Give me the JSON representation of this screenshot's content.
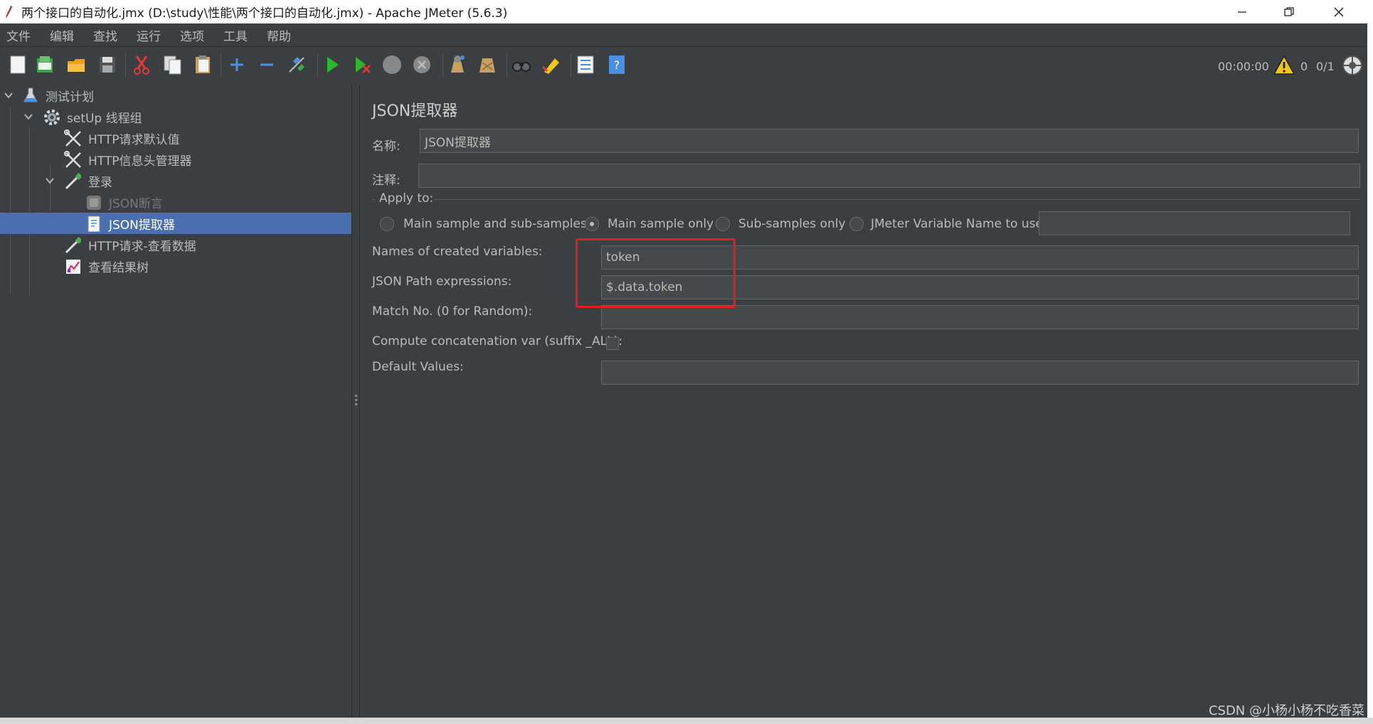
{
  "window": {
    "title": "两个接口的自动化.jmx (D:\\study\\性能\\两个接口的自动化.jmx) - Apache JMeter (5.6.3)",
    "minimize": "—",
    "maximize": "❐",
    "close": "✕"
  },
  "menu": [
    "文件",
    "编辑",
    "查找",
    "运行",
    "选项",
    "工具",
    "帮助"
  ],
  "toolbar": {
    "icons": [
      "new-icon",
      "templates-icon",
      "open-icon",
      "save-icon",
      "cut-icon",
      "copy-icon",
      "paste-icon",
      "expand-icon",
      "collapse-icon",
      "toggle-icon",
      "start-icon",
      "start-no-pause-icon",
      "stop-icon",
      "shutdown-icon",
      "clear-icon",
      "clear-all-icon",
      "search-icon",
      "reset-search-icon",
      "function-helper-icon",
      "help-icon"
    ],
    "elapsed_time": "00:00:00",
    "warning_count": "0",
    "threads": "0/1"
  },
  "tree": [
    {
      "label": "测试计划",
      "icon": "test-plan-icon",
      "expanded": true,
      "level": 0
    },
    {
      "label": "setUp 线程组",
      "icon": "gear-icon",
      "expanded": true,
      "level": 1
    },
    {
      "label": "HTTP请求默认值",
      "icon": "config-tools-icon",
      "level": 2
    },
    {
      "label": "HTTP信息头管理器",
      "icon": "config-tools-icon",
      "level": 2
    },
    {
      "label": "登录",
      "icon": "sampler-pipette-icon",
      "expanded": true,
      "level": 2
    },
    {
      "label": "JSON断言",
      "icon": "assertion-icon",
      "level": 3,
      "disabled": true
    },
    {
      "label": "JSON提取器",
      "icon": "extractor-icon",
      "level": 3,
      "selected": true
    },
    {
      "label": "HTTP请求-查看数据",
      "icon": "sampler-pipette-icon",
      "level": 2
    },
    {
      "label": "查看结果树",
      "icon": "listener-chart-icon",
      "level": 2
    }
  ],
  "panel": {
    "heading": "JSON提取器",
    "name_label": "名称:",
    "name_value": "JSON提取器",
    "comment_label": "注释:",
    "comment_value": "",
    "apply_to_label": "Apply to:",
    "apply_options": [
      {
        "label": "Main sample and sub-samples",
        "checked": false
      },
      {
        "label": "Main sample only",
        "checked": true
      },
      {
        "label": "Sub-samples only",
        "checked": false
      },
      {
        "label": "JMeter Variable Name to use",
        "checked": false
      }
    ],
    "jmeter_var_value": "",
    "names_label": "Names of created variables:",
    "names_value": "token",
    "jsonpath_label": "JSON Path expressions:",
    "jsonpath_value": "$.data.token",
    "match_label": "Match No. (0 for Random):",
    "match_value": "",
    "concat_label": "Compute concatenation var (suffix _ALL):",
    "concat_checked": false,
    "default_label": "Default Values:",
    "default_value": ""
  },
  "watermark": "CSDN @小杨小杨不吃香菜",
  "colors": {
    "background": "#3c3f41",
    "selection": "#4b6eaf",
    "highlight_box": "#e02020",
    "field_bg": "#45494a"
  }
}
